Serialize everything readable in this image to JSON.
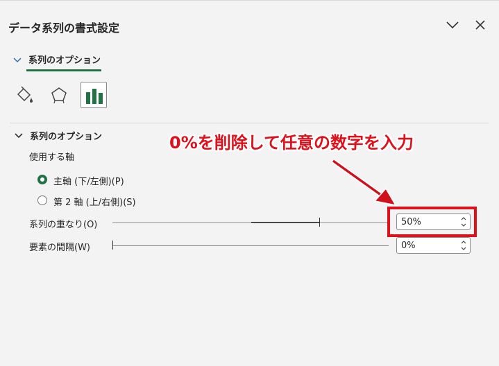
{
  "pane": {
    "title": "データ系列の書式設定"
  },
  "tab": {
    "label": "系列のオプション"
  },
  "section": {
    "label": "系列のオプション",
    "axis_label": "使用する軸",
    "radios": [
      {
        "label": "主軸 (下/左側)(P)",
        "selected": true
      },
      {
        "label": "第 2 軸 (上/右側)(S)",
        "selected": false
      }
    ],
    "overlap": {
      "label": "系列の重なり(O)",
      "value": "50%",
      "level_percent": 50
    },
    "gap": {
      "label": "要素の間隔(W)",
      "value": "0%",
      "level_percent": 0
    }
  },
  "annotation": {
    "text": "0%を削除して任意の数字を入力"
  },
  "colors": {
    "accent": "#217346",
    "highlight": "#e0101b",
    "background": "#f3f3f3"
  },
  "icons": [
    "chevron-down-icon",
    "close-icon",
    "paint-bucket-icon",
    "pentagon-icon",
    "bar-chart-icon",
    "spin-up-icon",
    "spin-down-icon"
  ]
}
